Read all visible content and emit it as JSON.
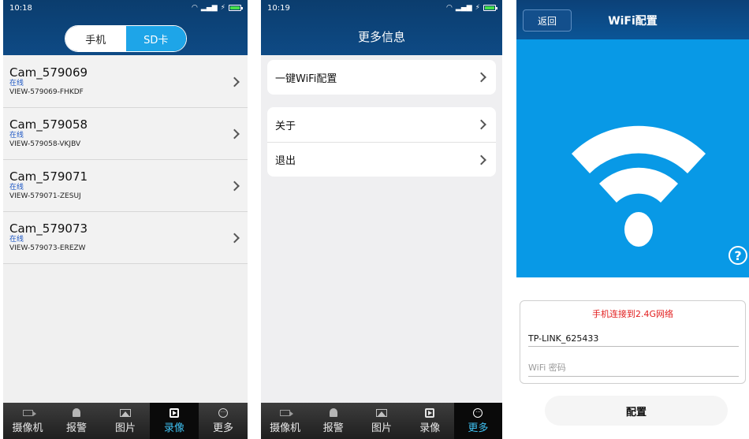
{
  "panel1": {
    "status": {
      "time": "10:18"
    },
    "segmented": {
      "phone": "手机",
      "sd": "SD卡"
    },
    "cameras": [
      {
        "name": "Cam_579069",
        "status": "在线",
        "uid": "VIEW-579069-FHKDF"
      },
      {
        "name": "Cam_579058",
        "status": "在线",
        "uid": "VIEW-579058-VKJBV"
      },
      {
        "name": "Cam_579071",
        "status": "在线",
        "uid": "VIEW-579071-ZESUJ"
      },
      {
        "name": "Cam_579073",
        "status": "在线",
        "uid": "VIEW-579073-EREZW"
      }
    ],
    "tabs": [
      "摄像机",
      "报警",
      "图片",
      "录像",
      "更多"
    ],
    "active_tab": "录像"
  },
  "panel2": {
    "status": {
      "time": "10:19"
    },
    "title": "更多信息",
    "group1": [
      "一键WiFi配置"
    ],
    "group2": [
      "关于",
      "退出"
    ],
    "tabs": [
      "摄像机",
      "报警",
      "图片",
      "录像",
      "更多"
    ],
    "active_tab": "更多"
  },
  "panel3": {
    "back_label": "返回",
    "title": "WiFi配置",
    "help_glyph": "?",
    "hint": "手机连接到2.4G网络",
    "ssid_value": "TP-LINK_625433",
    "password_placeholder": "WiFi 密码",
    "config_button": "配置"
  },
  "colors": {
    "header": "#0e4a85",
    "segment_active": "#1ea5e8",
    "online_text": "#1d57c4",
    "tab_active_text": "#3fc1f2",
    "hero_blue": "#0899e6",
    "hint_red": "#e21d1d"
  }
}
